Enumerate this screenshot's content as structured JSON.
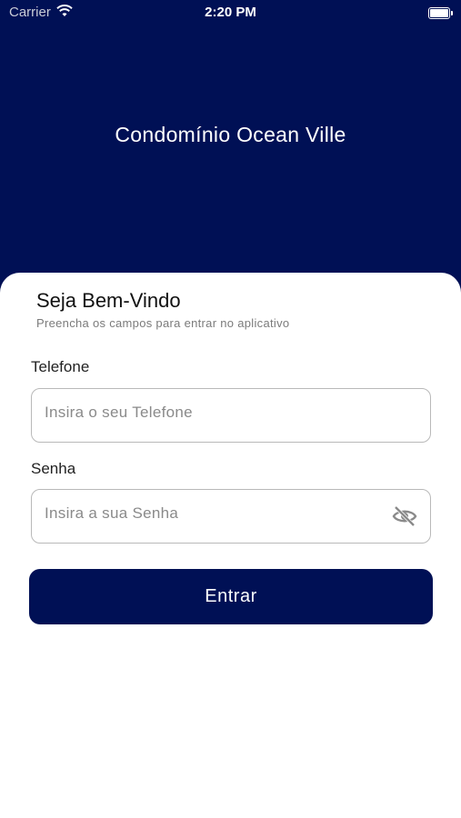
{
  "status_bar": {
    "carrier": "Carrier",
    "time": "2:20 PM"
  },
  "header": {
    "title": "Condomínio Ocean Ville"
  },
  "login": {
    "welcome": "Seja Bem-Vindo",
    "subtitle": "Preencha os campos para entrar no aplicativo",
    "phone_label": "Telefone",
    "phone_placeholder": "Insira o seu Telefone",
    "password_label": "Senha",
    "password_placeholder": "Insira a sua Senha",
    "submit_label": "Entrar"
  },
  "icons": {
    "wifi": "wifi-icon",
    "battery": "battery-icon",
    "password_toggle": "eye-off-icon"
  },
  "colors": {
    "brand": "#001055",
    "background": "#ffffff",
    "input_border": "#b9b9b9"
  }
}
